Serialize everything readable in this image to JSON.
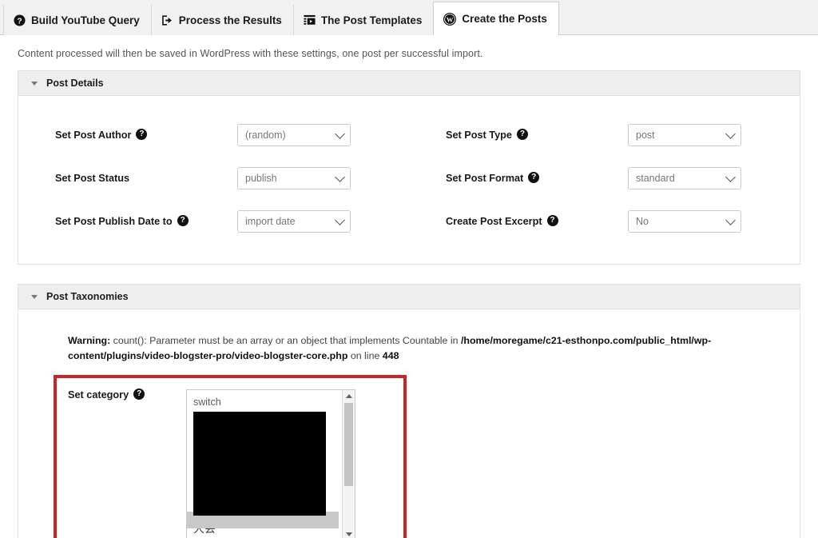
{
  "tabs": [
    {
      "label": "Build YouTube Query",
      "icon": "question-circle-icon",
      "active": false
    },
    {
      "label": "Process the Results",
      "icon": "export-arrow-icon",
      "active": false
    },
    {
      "label": "The Post Templates",
      "icon": "template-list-icon",
      "active": false
    },
    {
      "label": "Create the Posts",
      "icon": "wordpress-logo-icon",
      "active": true
    }
  ],
  "intro": "Content processed will then be saved in WordPress with these settings, one post per successful import.",
  "panels": {
    "post_details": {
      "title": "Post Details",
      "fields": [
        {
          "label": "Set Post Author",
          "help": true,
          "value": "(random)"
        },
        {
          "label": "Set Post Type",
          "help": true,
          "value": "post"
        },
        {
          "label": "Set Post Status",
          "help": false,
          "value": "publish"
        },
        {
          "label": "Set Post Format",
          "help": true,
          "value": "standard"
        },
        {
          "label": "Set Post Publish Date to",
          "help": true,
          "value": "import date"
        },
        {
          "label": "Create Post Excerpt",
          "help": true,
          "value": "No"
        }
      ]
    },
    "post_taxonomies": {
      "title": "Post Taxonomies",
      "warning": {
        "prefix": "Warning:",
        "message": " count(): Parameter must be an array or an object that implements Countable in ",
        "path": "/home/moregame/c21-esthonpo.com/public_html/wp-content/plugins/video-blogster-pro/video-blogster-core.php",
        "suffix": " on line ",
        "line": "448"
      },
      "category": {
        "label": "Set category",
        "help": true,
        "options_visible": [
          "switch",
          "大会"
        ]
      }
    }
  },
  "colors": {
    "highlight_red": "#cf2222",
    "panel_header_bg": "#eeeeee",
    "page_bg": "#f1f1f1"
  },
  "help_glyph": "?"
}
